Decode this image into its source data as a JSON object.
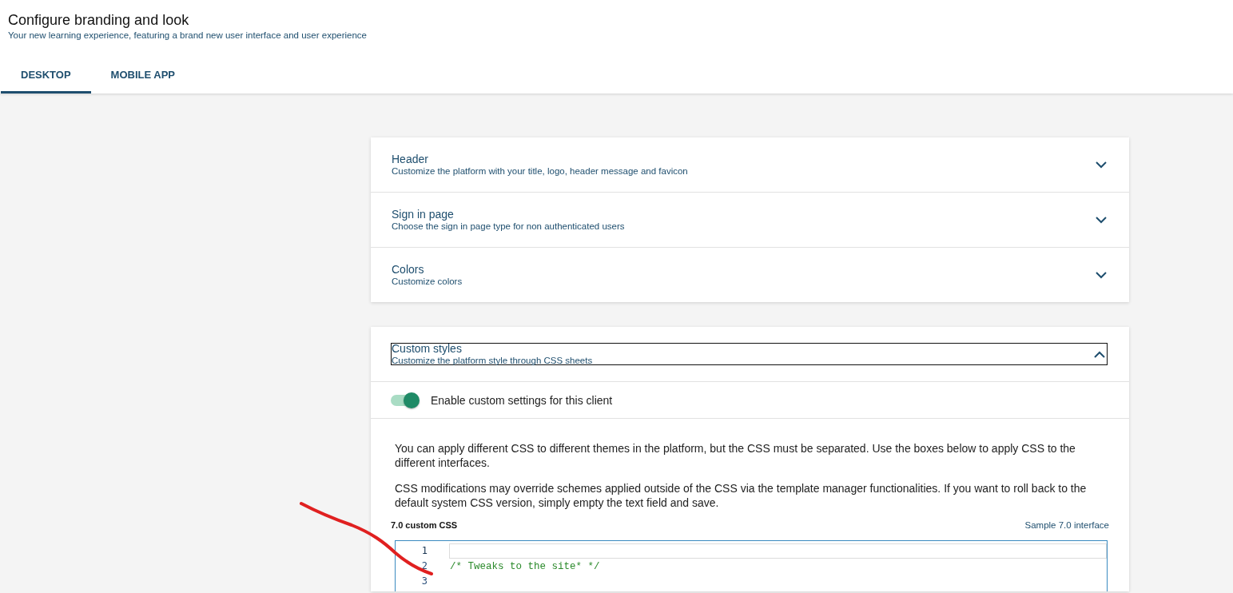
{
  "page": {
    "title": "Configure branding and look",
    "subtitle": "Your new learning experience, featuring a brand new user interface and user experience"
  },
  "tabs": [
    {
      "label": "DESKTOP",
      "selected": true
    },
    {
      "label": "MOBILE APP",
      "selected": false
    }
  ],
  "sections": [
    {
      "title": "Header",
      "subtitle": "Customize the platform with your title, logo, header message and favicon",
      "expanded": false,
      "focused": false
    },
    {
      "title": "Sign in page",
      "subtitle": "Choose the sign in page type for non authenticated users",
      "expanded": false,
      "focused": false
    },
    {
      "title": "Colors",
      "subtitle": "Customize colors",
      "expanded": false,
      "focused": false
    }
  ],
  "custom_styles": {
    "title": "Custom styles",
    "subtitle": "Customize the platform style through CSS sheets",
    "expanded": true,
    "focused": true,
    "toggle": {
      "label": "Enable custom settings for this client",
      "on": true
    },
    "paragraphs": [
      "You can apply different CSS to different themes in the platform, but the CSS must be separated. Use the boxes below to apply CSS to the different interfaces.",
      "CSS modifications may override schemes applied outside of the CSS via the template manager functionalities. If you want to roll back to the default system CSS version, simply empty the text field and save."
    ],
    "editor": {
      "label": "7.0 custom CSS",
      "link": "Sample 7.0 interface",
      "lines": [
        {
          "number": "1",
          "active": true
        },
        {
          "number": "2",
          "code": "/* Tweaks to the site* */",
          "active": false
        },
        {
          "number": "3",
          "active": false
        }
      ]
    }
  }
}
